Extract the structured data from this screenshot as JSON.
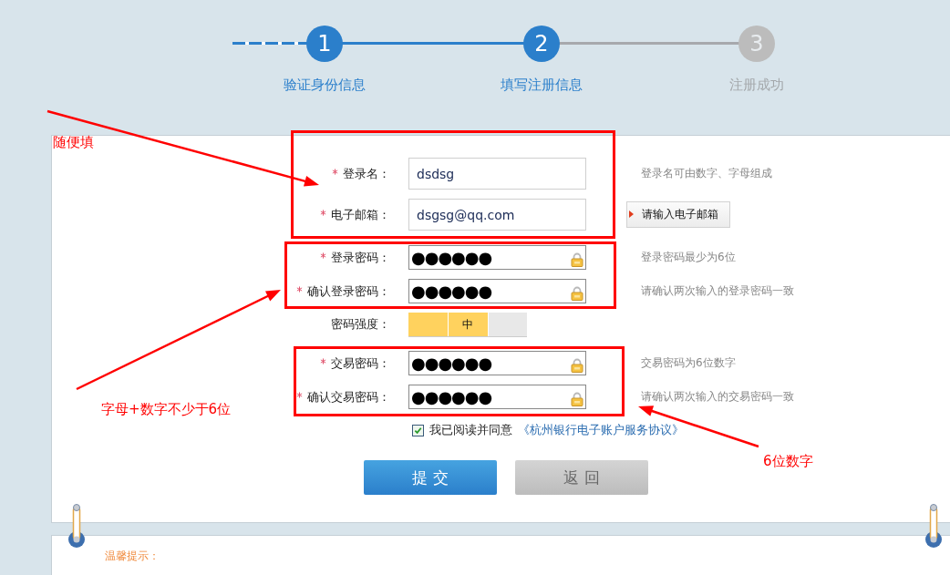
{
  "steps": [
    {
      "number": "1",
      "label": "验证身份信息",
      "active": true
    },
    {
      "number": "2",
      "label": "填写注册信息",
      "active": true
    },
    {
      "number": "3",
      "label": "注册成功",
      "active": false
    }
  ],
  "fields": [
    {
      "kind": "text",
      "required": true,
      "label": "登录名：",
      "value": "dsdsg",
      "hint": {
        "kind": "note",
        "text": "登录名可由数字、字母组成"
      }
    },
    {
      "kind": "text",
      "required": true,
      "label": "电子邮箱：",
      "value": "dsgsg@qq.com",
      "hint": {
        "kind": "tip",
        "text": "请输入电子邮箱"
      }
    },
    {
      "kind": "password",
      "required": true,
      "label": "登录密码：",
      "value": "●●●●●●",
      "hint": {
        "kind": "note",
        "text": "登录密码最少为6位"
      }
    },
    {
      "kind": "password",
      "required": true,
      "label": "确认登录密码：",
      "value": "●●●●●●",
      "hint": {
        "kind": "note",
        "text": "请确认两次输入的登录密码一致"
      }
    },
    {
      "kind": "strength",
      "required": false,
      "label": "密码强度：",
      "level": 0.67,
      "value": "中"
    },
    {
      "kind": "password",
      "required": true,
      "label": "交易密码：",
      "value": "●●●●●●",
      "hint": {
        "kind": "note",
        "text": "交易密码为6位数字"
      }
    },
    {
      "kind": "password",
      "required": true,
      "label": "确认交易密码：",
      "value": "●●●●●●",
      "hint": {
        "kind": "note",
        "text": "请确认两次输入的交易密码一致"
      }
    }
  ],
  "agreement": {
    "checked": true,
    "text": "我已阅读并同意",
    "link": "《杭州银行电子账户服务协议》"
  },
  "buttons": [
    {
      "label": "提 交",
      "kind": "primary"
    },
    {
      "label": "返 回",
      "kind": "secondary"
    }
  ],
  "tips": {
    "title": "温馨提示："
  },
  "annotations": [
    {
      "text": "随便填"
    },
    {
      "text": "字母+数字不少于6位"
    },
    {
      "text": "6位数字"
    }
  ]
}
